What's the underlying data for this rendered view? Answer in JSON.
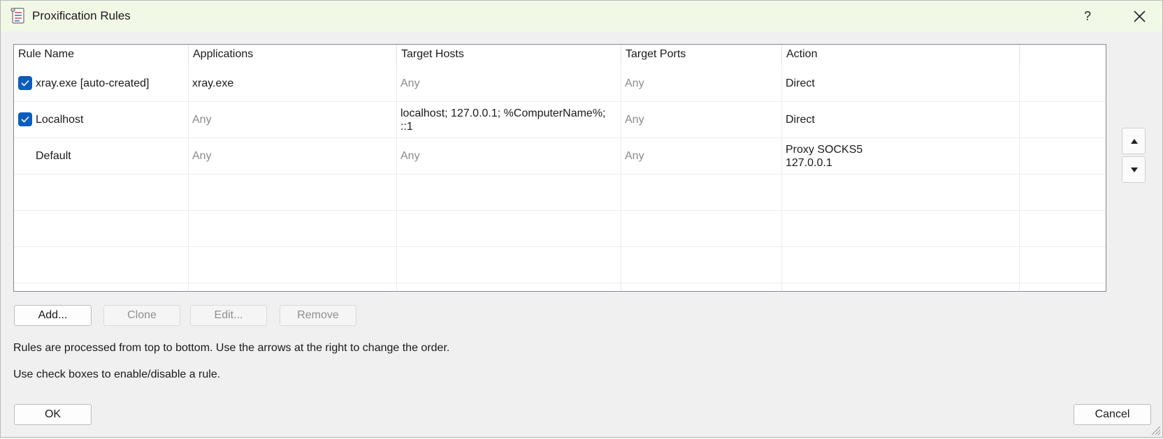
{
  "window": {
    "title": "Proxification Rules",
    "help_label": "?"
  },
  "table": {
    "columns": [
      "Rule Name",
      "Applications",
      "Target Hosts",
      "Target Ports",
      "Action"
    ],
    "rows": [
      {
        "enabled": true,
        "name": "xray.exe [auto-created]",
        "applications": "xray.exe",
        "target_hosts": "Any",
        "target_ports": "Any",
        "action": "Direct",
        "action_line2": ""
      },
      {
        "enabled": true,
        "name": "Localhost",
        "applications": "Any",
        "target_hosts": "localhost; 127.0.0.1; %ComputerName%;",
        "target_hosts_line2": "::1",
        "target_ports": "Any",
        "action": "Direct",
        "action_line2": ""
      },
      {
        "enabled": false,
        "name": "Default",
        "applications": "Any",
        "target_hosts": "Any",
        "target_ports": "Any",
        "action": "Proxy SOCKS5",
        "action_line2": "127.0.0.1"
      }
    ]
  },
  "buttons": {
    "add": "Add...",
    "clone": "Clone",
    "edit": "Edit...",
    "remove": "Remove",
    "ok": "OK",
    "cancel": "Cancel"
  },
  "notes": {
    "order": "Rules are processed from top to bottom. Use the arrows at the right to change the order.",
    "checkboxes": "Use check boxes to enable/disable a rule."
  },
  "colors": {
    "title_bar": "#f2f8e6",
    "checkbox": "#0b5cbe",
    "muted_text": "#8a8a8a"
  }
}
